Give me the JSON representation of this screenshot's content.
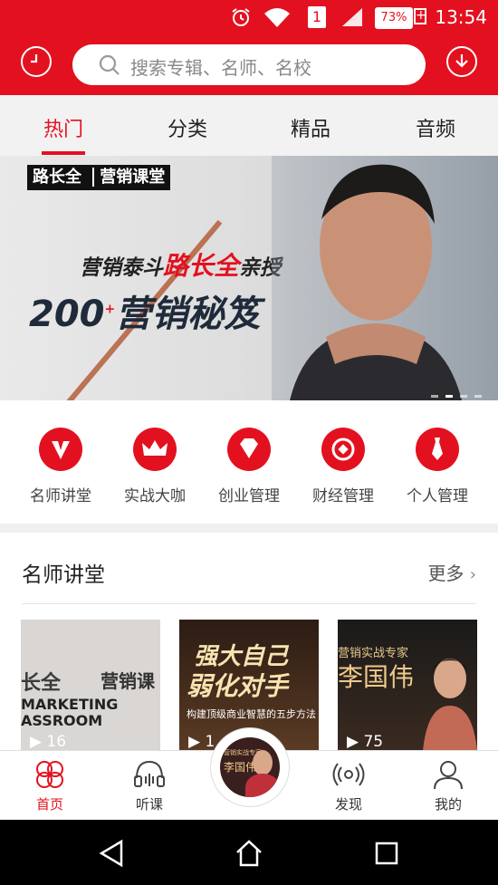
{
  "status_bar": {
    "time": "13:54",
    "battery": "73%",
    "sim": "1",
    "icons": [
      "alarm-icon",
      "wifi-icon",
      "sim-icon",
      "signal-icon",
      "battery-icon"
    ]
  },
  "header": {
    "left_icon": "clock-icon",
    "right_icon": "download-icon",
    "search": {
      "placeholder": "搜索专辑、名师、名校",
      "icon": "search-icon"
    }
  },
  "tabs": [
    {
      "label": "热门",
      "active": true
    },
    {
      "label": "分类",
      "active": false
    },
    {
      "label": "精品",
      "active": false
    },
    {
      "label": "音频",
      "active": false
    }
  ],
  "banner": {
    "brand": "路长全",
    "brand_tag": "营销课堂",
    "line1_pre": "营销泰斗",
    "line1_name": "路长全",
    "line1_post": "亲授",
    "line2_num": "200",
    "line2_sup": "+",
    "line2_text": "营销秘笈",
    "page_dots": 4,
    "active_dot": 1
  },
  "quick_links": [
    {
      "label": "名师讲堂",
      "icon": "v-icon"
    },
    {
      "label": "实战大咖",
      "icon": "crown-icon"
    },
    {
      "label": "创业管理",
      "icon": "diamond-icon"
    },
    {
      "label": "财经管理",
      "icon": "coin-icon"
    },
    {
      "label": "个人管理",
      "icon": "tie-icon"
    }
  ],
  "section": {
    "title": "名师讲堂",
    "more": "更多",
    "cards": [
      {
        "overlay1": "长全",
        "overlay2": "营销课",
        "overlay3": "MARKETING",
        "overlay4": "ASSROOM",
        "count": "16"
      },
      {
        "overlay1": "强大自己",
        "overlay2": "弱化对手",
        "overlay3": "构建顶级商业智慧的五步方法",
        "count": "1"
      },
      {
        "overlay1": "营销实战专家",
        "overlay2": "李国伟",
        "count": "75"
      }
    ]
  },
  "center_thumb": {
    "subtitle": "营销实战专家",
    "name": "李国伟"
  },
  "bottom_tabs": [
    {
      "label": "首页",
      "icon": "clover-icon",
      "active": true
    },
    {
      "label": "听课",
      "icon": "headphones-icon",
      "active": false
    },
    {
      "label": "发现",
      "icon": "broadcast-icon",
      "active": false
    },
    {
      "label": "我的",
      "icon": "person-icon",
      "active": false
    }
  ],
  "system_nav": [
    "back-icon",
    "home-icon",
    "recents-icon"
  ],
  "colors": {
    "accent": "#e3111f",
    "text": "#333333",
    "muted": "#888888",
    "tab_bg": "#f2f2f2"
  }
}
